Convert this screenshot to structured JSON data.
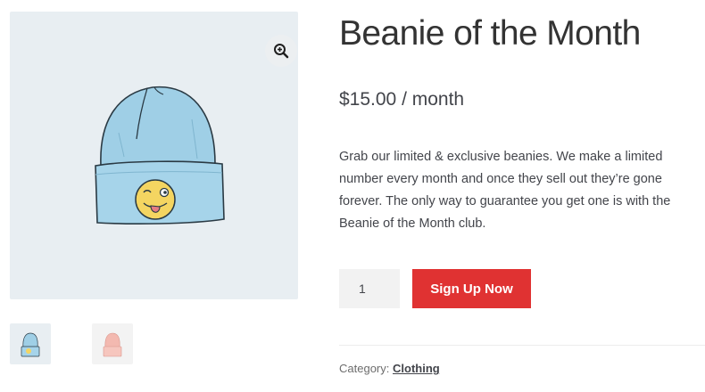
{
  "product": {
    "title": "Beanie of the Month",
    "price": "$15.00 / month",
    "description": "Grab our limited & exclusive beanies. We make a limited number every month and once they sell out they’re gone forever. The only way to guarantee you get one is with the Beanie of the Month club.",
    "quantity": "1",
    "add_button_label": "Sign Up Now",
    "category_label": "Category:",
    "category_value": "Clothing"
  },
  "gallery": {
    "zoom_icon": "zoom-in-icon",
    "main_image": "blue-beanie-with-emoji",
    "thumbnails": [
      "blue-beanie",
      "pink-beanie"
    ]
  },
  "colors": {
    "accent": "#e03232",
    "gallery_bg": "#e8eef2",
    "beanie_blue": "#9fcfe6",
    "beanie_pink": "#f3b9b0"
  }
}
